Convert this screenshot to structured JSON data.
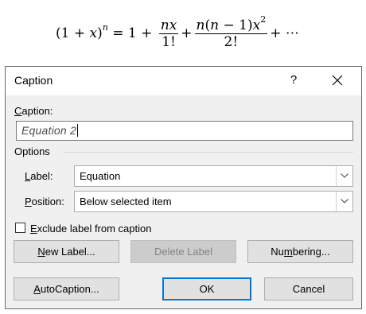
{
  "equation": {
    "lhs_open": "(1 + ",
    "lhs_x": "x",
    "lhs_close": ")",
    "lhs_exp": "n",
    "eq": " = 1 + ",
    "f1_num": "nx",
    "f1_den": "1!",
    "plus1": "+",
    "f2_num_a": "n",
    "f2_num_b": "(",
    "f2_num_c": "n",
    "f2_num_d": " − 1)",
    "f2_num_e": "x",
    "f2_num_exp": "2",
    "f2_den": "2!",
    "tail": "+ ⋯"
  },
  "dialog": {
    "title": "Caption",
    "help_glyph": "?",
    "caption_label_u": "C",
    "caption_label_rest": "aption:",
    "caption_value": "Equation 2",
    "options_heading": "Options",
    "label_label_u": "L",
    "label_label_rest": "abel:",
    "label_value": "Equation",
    "position_label_u": "P",
    "position_label_rest": "osition:",
    "position_value": "Below selected item",
    "exclude_u": "E",
    "exclude_rest": "xclude label from caption",
    "exclude_checked": false,
    "new_label_u": "N",
    "new_label_rest": "ew Label...",
    "delete_label": "Delete Label",
    "numbering_a": "Nu",
    "numbering_u": "m",
    "numbering_b": "bering...",
    "autocaption_u": "A",
    "autocaption_rest": "utoCaption...",
    "ok": "OK",
    "cancel": "Cancel"
  },
  "colors": {
    "dialog_bg": "#f0f0f0",
    "default_button_border": "#0078d7",
    "disabled_text": "#838383"
  }
}
